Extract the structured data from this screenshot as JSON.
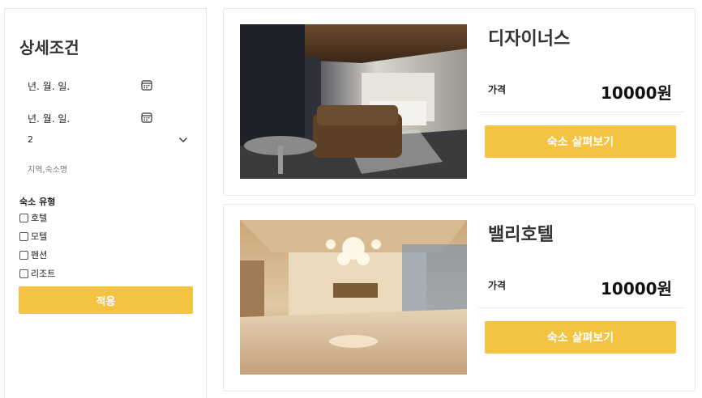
{
  "filter": {
    "title": "상세조건",
    "checkin_value": "년. 월. 일.",
    "checkout_value": "년. 월. 일.",
    "guests_value": "2",
    "place_placeholder": "지역,숙소명",
    "type_label": "숙소 유형",
    "types": [
      {
        "label": "호텔",
        "checked": false
      },
      {
        "label": "모텔",
        "checked": false
      },
      {
        "label": "펜션",
        "checked": false
      },
      {
        "label": "리조트",
        "checked": false
      }
    ],
    "apply_label": "적용"
  },
  "listings": [
    {
      "name": "디자이너스",
      "price_label": "가격",
      "price": "10000원",
      "button_label": "숙소 살펴보기"
    },
    {
      "name": "밸리호텔",
      "price_label": "가격",
      "price": "10000원",
      "button_label": "숙소 살펴보기"
    }
  ],
  "colors": {
    "accent": "#f5c342",
    "border": "#e6e6e6"
  },
  "icons": {
    "calendar": "calendar-icon",
    "dropdown": "chevron-down-icon"
  }
}
